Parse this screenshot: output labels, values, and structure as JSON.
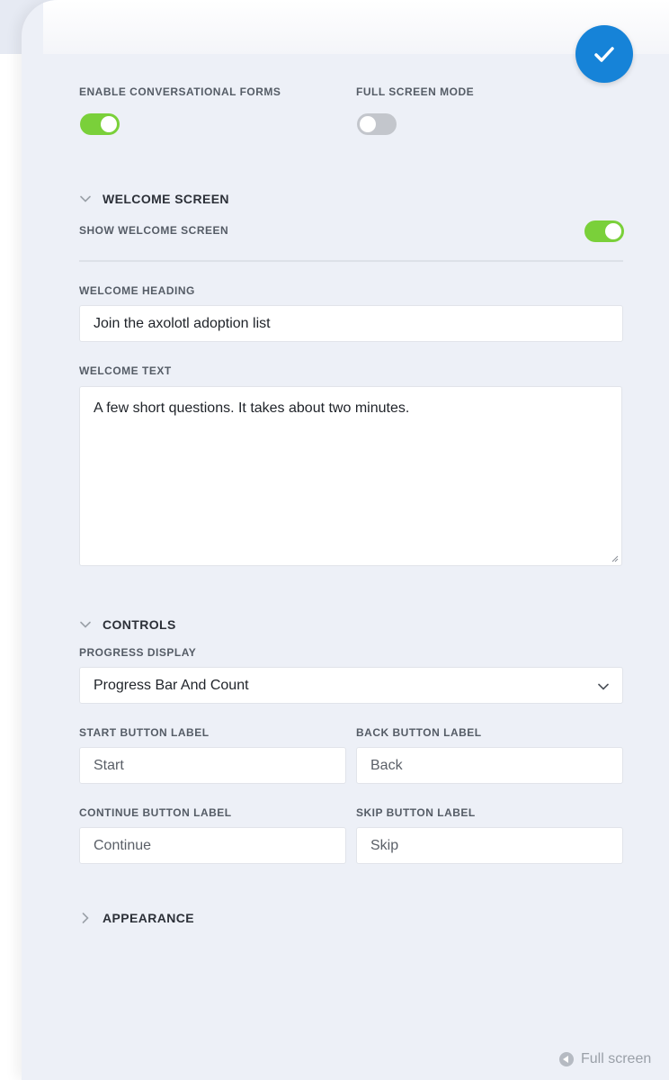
{
  "settings": {
    "enable_label": "ENABLE CONVERSATIONAL FORMS",
    "enable_on": true,
    "fullscreen_label": "FULL SCREEN MODE",
    "fullscreen_on": false
  },
  "welcome": {
    "section_title": "WELCOME SCREEN",
    "show_label": "SHOW WELCOME SCREEN",
    "show_on": true,
    "heading_label": "WELCOME HEADING",
    "heading_value": "Join the axolotl adoption list",
    "text_label": "WELCOME TEXT",
    "text_value": "A few short questions. It takes about two minutes."
  },
  "controls": {
    "section_title": "CONTROLS",
    "progress_label": "PROGRESS DISPLAY",
    "progress_value": "Progress Bar And Count",
    "start_label": "START BUTTON LABEL",
    "start_value": "Start",
    "back_label": "BACK BUTTON LABEL",
    "back_value": "Back",
    "continue_label": "CONTINUE BUTTON LABEL",
    "continue_value": "Continue",
    "skip_label": "SKIP BUTTON LABEL",
    "skip_value": "Skip"
  },
  "appearance": {
    "section_title": "APPEARANCE"
  },
  "footer": {
    "fullscreen_link": "Full screen"
  },
  "colors": {
    "accent": "#1683d8",
    "toggle_on": "#7ad03a",
    "toggle_off": "#c3c6cc"
  },
  "icons": {
    "save": "checkmark-icon",
    "section_open": "chevron-down-icon",
    "section_closed": "chevron-right-icon",
    "fullscreen": "caret-left-circle-icon"
  }
}
